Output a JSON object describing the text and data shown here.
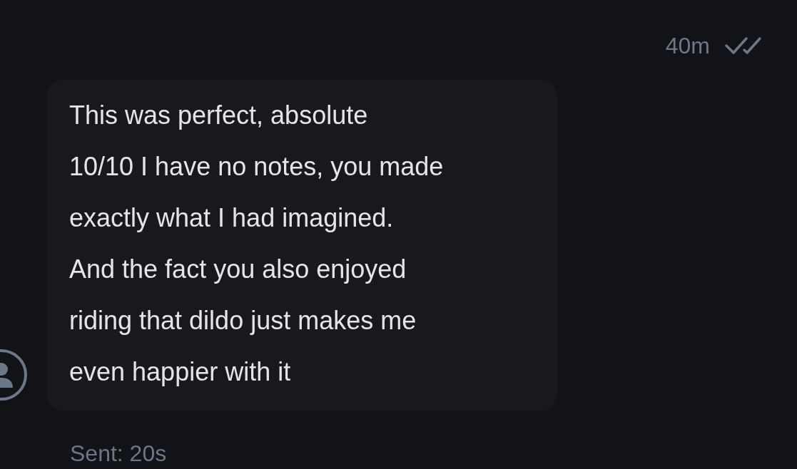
{
  "header": {
    "time": "40m",
    "read": true
  },
  "message": {
    "lines": [
      "This was perfect, absolute",
      "10/10 I have no notes, you made",
      "exactly what I had imagined.",
      "And the fact you also enjoyed",
      "riding that dildo just makes me",
      "even happier with it"
    ]
  },
  "footer": {
    "status": "Sent: 20s"
  }
}
